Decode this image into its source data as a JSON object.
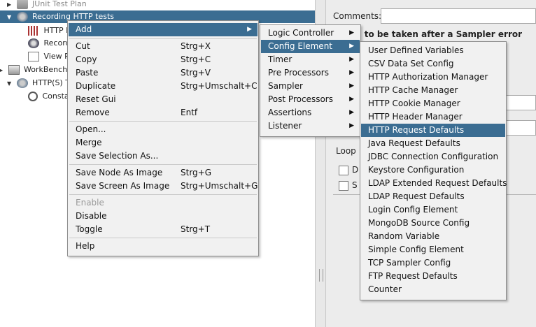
{
  "tree": {
    "items": [
      {
        "label": "JUnit Test Plan"
      },
      {
        "label": "Recording HTTP tests"
      },
      {
        "label": "HTTP R"
      },
      {
        "label": "Record"
      },
      {
        "label": "View R"
      },
      {
        "label": "WorkBench"
      },
      {
        "label": "HTTP(S) T"
      },
      {
        "label": "Consta"
      }
    ]
  },
  "right_panel": {
    "comments_label": "Comments:",
    "error_action_label": "n to be taken after a Sampler error",
    "loop_label": "Loop",
    "checkbox1_label": "D",
    "checkbox2_label": "S"
  },
  "context_menu": {
    "add": "Add",
    "cut": "Cut",
    "cut_key": "Strg+X",
    "copy": "Copy",
    "copy_key": "Strg+C",
    "paste": "Paste",
    "paste_key": "Strg+V",
    "duplicate": "Duplicate",
    "duplicate_key": "Strg+Umschalt+C",
    "reset_gui": "Reset Gui",
    "remove": "Remove",
    "remove_key": "Entf",
    "open": "Open...",
    "merge": "Merge",
    "save_selection": "Save Selection As...",
    "save_node_image": "Save Node As Image",
    "save_node_image_key": "Strg+G",
    "save_screen_image": "Save Screen As Image",
    "save_screen_image_key": "Strg+Umschalt+G",
    "enable": "Enable",
    "disable": "Disable",
    "toggle": "Toggle",
    "toggle_key": "Strg+T",
    "help": "Help"
  },
  "add_menu": {
    "items": [
      "Logic Controller",
      "Config Element",
      "Timer",
      "Pre Processors",
      "Sampler",
      "Post Processors",
      "Assertions",
      "Listener"
    ],
    "highlighted": "Config Element"
  },
  "config_menu": {
    "items": [
      "User Defined Variables",
      "CSV Data Set Config",
      "HTTP Authorization Manager",
      "HTTP Cache Manager",
      "HTTP Cookie Manager",
      "HTTP Header Manager",
      "HTTP Request Defaults",
      "Java Request Defaults",
      "JDBC Connection Configuration",
      "Keystore Configuration",
      "LDAP Extended Request Defaults",
      "LDAP Request Defaults",
      "Login Config Element",
      "MongoDB Source Config",
      "Random Variable",
      "Simple Config Element",
      "TCP Sampler Config",
      "FTP Request Defaults",
      "Counter"
    ],
    "highlighted": "HTTP Request Defaults"
  },
  "colors": {
    "highlight": "#3b6d92",
    "menu_bg": "#f1f1f1"
  }
}
